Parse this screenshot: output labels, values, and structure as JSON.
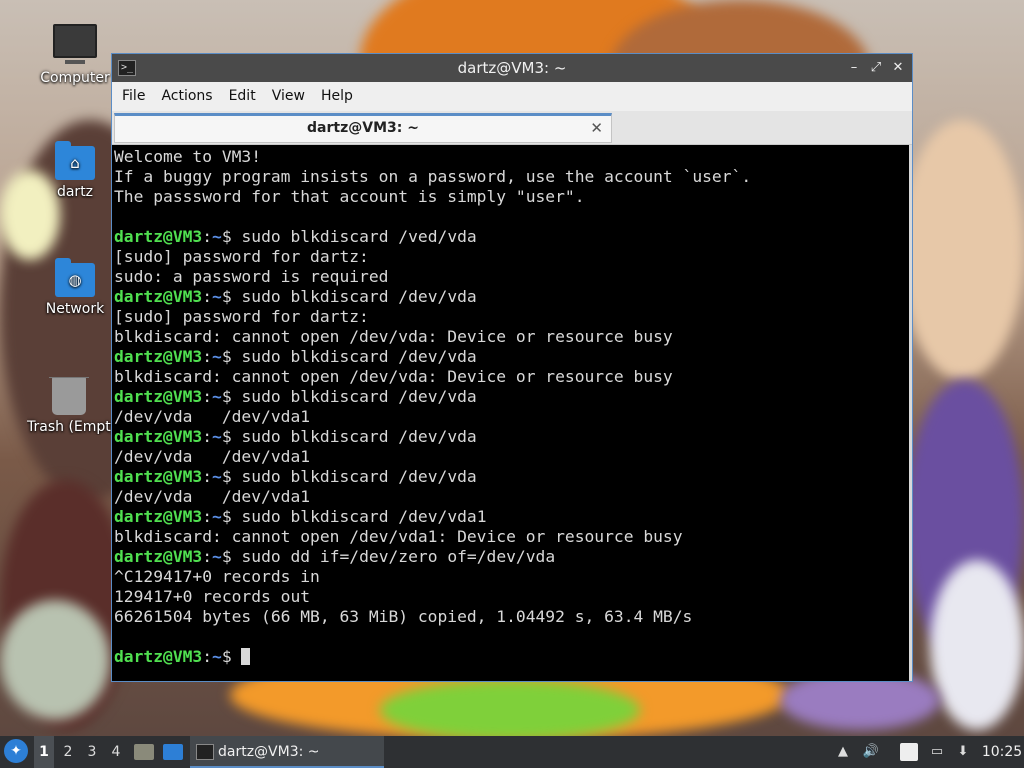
{
  "desktop": {
    "icons": [
      {
        "label": "Computer",
        "icon": "computer-icon"
      },
      {
        "label": "dartz",
        "icon": "home-folder-icon"
      },
      {
        "label": "Network",
        "icon": "network-folder-icon"
      },
      {
        "label": "Trash (Empty)",
        "icon": "trash-icon"
      }
    ]
  },
  "window": {
    "title": "dartz@VM3: ~",
    "menu": [
      "File",
      "Actions",
      "Edit",
      "View",
      "Help"
    ],
    "tab": {
      "label": "dartz@VM3: ~",
      "close_glyph": "✕"
    },
    "controls": {
      "minimize": "–",
      "maximize": "⤢",
      "close": "✕"
    }
  },
  "terminal": {
    "prompt_user": "dartz@VM3",
    "prompt_path": "~",
    "lines": [
      {
        "text": "Welcome to VM3!"
      },
      {
        "text": "If a buggy program insists on a password, use the account `user`."
      },
      {
        "text": "The passsword for that account is simply \"user\"."
      },
      {
        "text": ""
      },
      {
        "cmd": "sudo blkdiscard /ved/vda"
      },
      {
        "text": "[sudo] password for dartz:"
      },
      {
        "text": "sudo: a password is required"
      },
      {
        "cmd": "sudo blkdiscard /dev/vda"
      },
      {
        "text": "[sudo] password for dartz:"
      },
      {
        "text": "blkdiscard: cannot open /dev/vda: Device or resource busy"
      },
      {
        "cmd": "sudo blkdiscard /dev/vda"
      },
      {
        "text": "blkdiscard: cannot open /dev/vda: Device or resource busy"
      },
      {
        "cmd": "sudo blkdiscard /dev/vda"
      },
      {
        "text": "/dev/vda   /dev/vda1"
      },
      {
        "cmd": "sudo blkdiscard /dev/vda"
      },
      {
        "text": "/dev/vda   /dev/vda1"
      },
      {
        "cmd": "sudo blkdiscard /dev/vda"
      },
      {
        "text": "/dev/vda   /dev/vda1"
      },
      {
        "cmd": "sudo blkdiscard /dev/vda1"
      },
      {
        "text": "blkdiscard: cannot open /dev/vda1: Device or resource busy"
      },
      {
        "cmd": "sudo dd if=/dev/zero of=/dev/vda"
      },
      {
        "text": "^C129417+0 records in"
      },
      {
        "text": "129417+0 records out"
      },
      {
        "text": "66261504 bytes (66 MB, 63 MiB) copied, 1.04492 s, 63.4 MB/s"
      },
      {
        "text": ""
      },
      {
        "cmd": "",
        "cursor": true
      }
    ]
  },
  "taskbar": {
    "workspaces": [
      "1",
      "2",
      "3",
      "4"
    ],
    "active_workspace": "1",
    "task_label": "dartz@VM3: ~",
    "clock": "10:25"
  },
  "colors": {
    "accent": "#5b8dc6",
    "prompt_user": "#50e050",
    "prompt_path": "#5b8fe6"
  }
}
